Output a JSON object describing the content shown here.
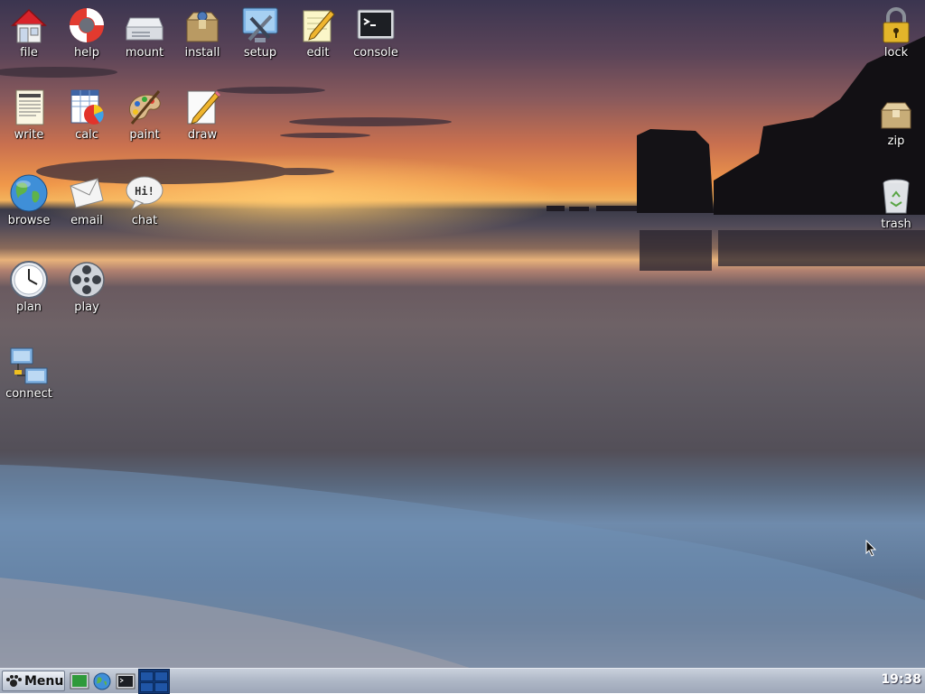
{
  "desktop": {
    "icons_left": [
      {
        "id": "file",
        "label": "file"
      },
      {
        "id": "help",
        "label": "help"
      },
      {
        "id": "mount",
        "label": "mount"
      },
      {
        "id": "install",
        "label": "install"
      },
      {
        "id": "setup",
        "label": "setup"
      },
      {
        "id": "edit",
        "label": "edit"
      },
      {
        "id": "console",
        "label": "console"
      },
      {
        "id": "write",
        "label": "write"
      },
      {
        "id": "calc",
        "label": "calc"
      },
      {
        "id": "paint",
        "label": "paint"
      },
      {
        "id": "draw",
        "label": "draw"
      },
      {
        "id": "browse",
        "label": "browse"
      },
      {
        "id": "email",
        "label": "email"
      },
      {
        "id": "chat",
        "label": "chat"
      },
      {
        "id": "plan",
        "label": "plan"
      },
      {
        "id": "play",
        "label": "play"
      },
      {
        "id": "connect",
        "label": "connect"
      }
    ],
    "icons_right": [
      {
        "id": "lock",
        "label": "lock"
      },
      {
        "id": "zip",
        "label": "zip"
      },
      {
        "id": "trash",
        "label": "trash"
      }
    ],
    "chat_bubble_text": "Hi!"
  },
  "taskbar": {
    "menu_label": "Menu",
    "launchers": [
      "desktop-icon",
      "browser-icon",
      "terminal-icon"
    ],
    "clock": "19:38"
  },
  "colors": {
    "taskbar": "#aeb7c6",
    "label_text": "#ffffff",
    "pager": "#123a78"
  }
}
